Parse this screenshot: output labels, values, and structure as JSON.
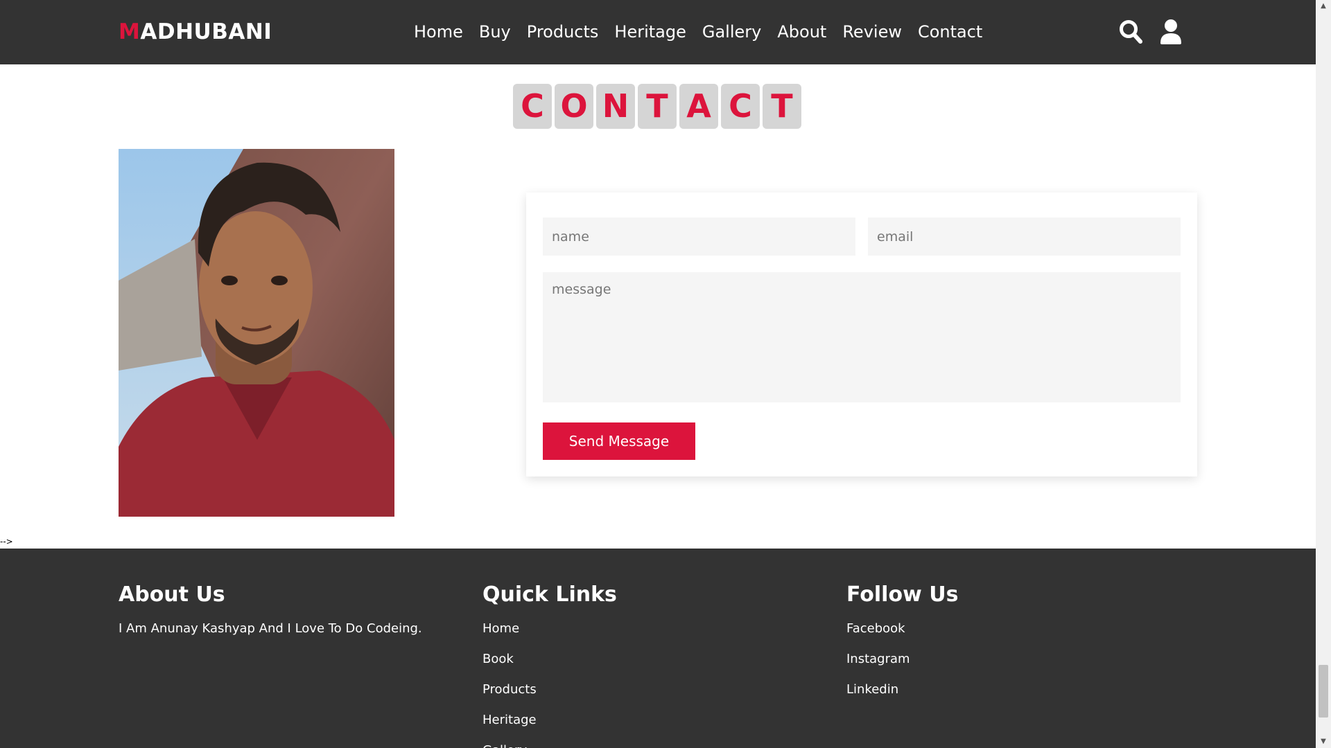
{
  "header": {
    "logo_first": "M",
    "logo_rest": "ADHUBANI",
    "nav": [
      "Home",
      "Buy",
      "Products",
      "Heritage",
      "Gallery",
      "About",
      "Review",
      "Contact"
    ],
    "icons": [
      "search-icon",
      "user-icon"
    ]
  },
  "title_letters": [
    "C",
    "O",
    "N",
    "T",
    "A",
    "C",
    "T"
  ],
  "form": {
    "name_placeholder": "name",
    "email_placeholder": "email",
    "message_placeholder": "message",
    "send_label": "Send Message"
  },
  "stray_text": "-->",
  "footer": {
    "about": {
      "heading": "About Us",
      "text": "I Am Anunay Kashyap And I Love To Do Codeing."
    },
    "quick_links": {
      "heading": "Quick Links",
      "items": [
        "Home",
        "Book",
        "Products",
        "Heritage",
        "Gallery"
      ]
    },
    "follow": {
      "heading": "Follow Us",
      "items": [
        "Facebook",
        "Instagram",
        "Linkedin"
      ]
    }
  },
  "colors": {
    "accent": "#dc143c",
    "dark": "#333333",
    "tile": "#d5d5d5",
    "field": "#f5f5f5"
  }
}
